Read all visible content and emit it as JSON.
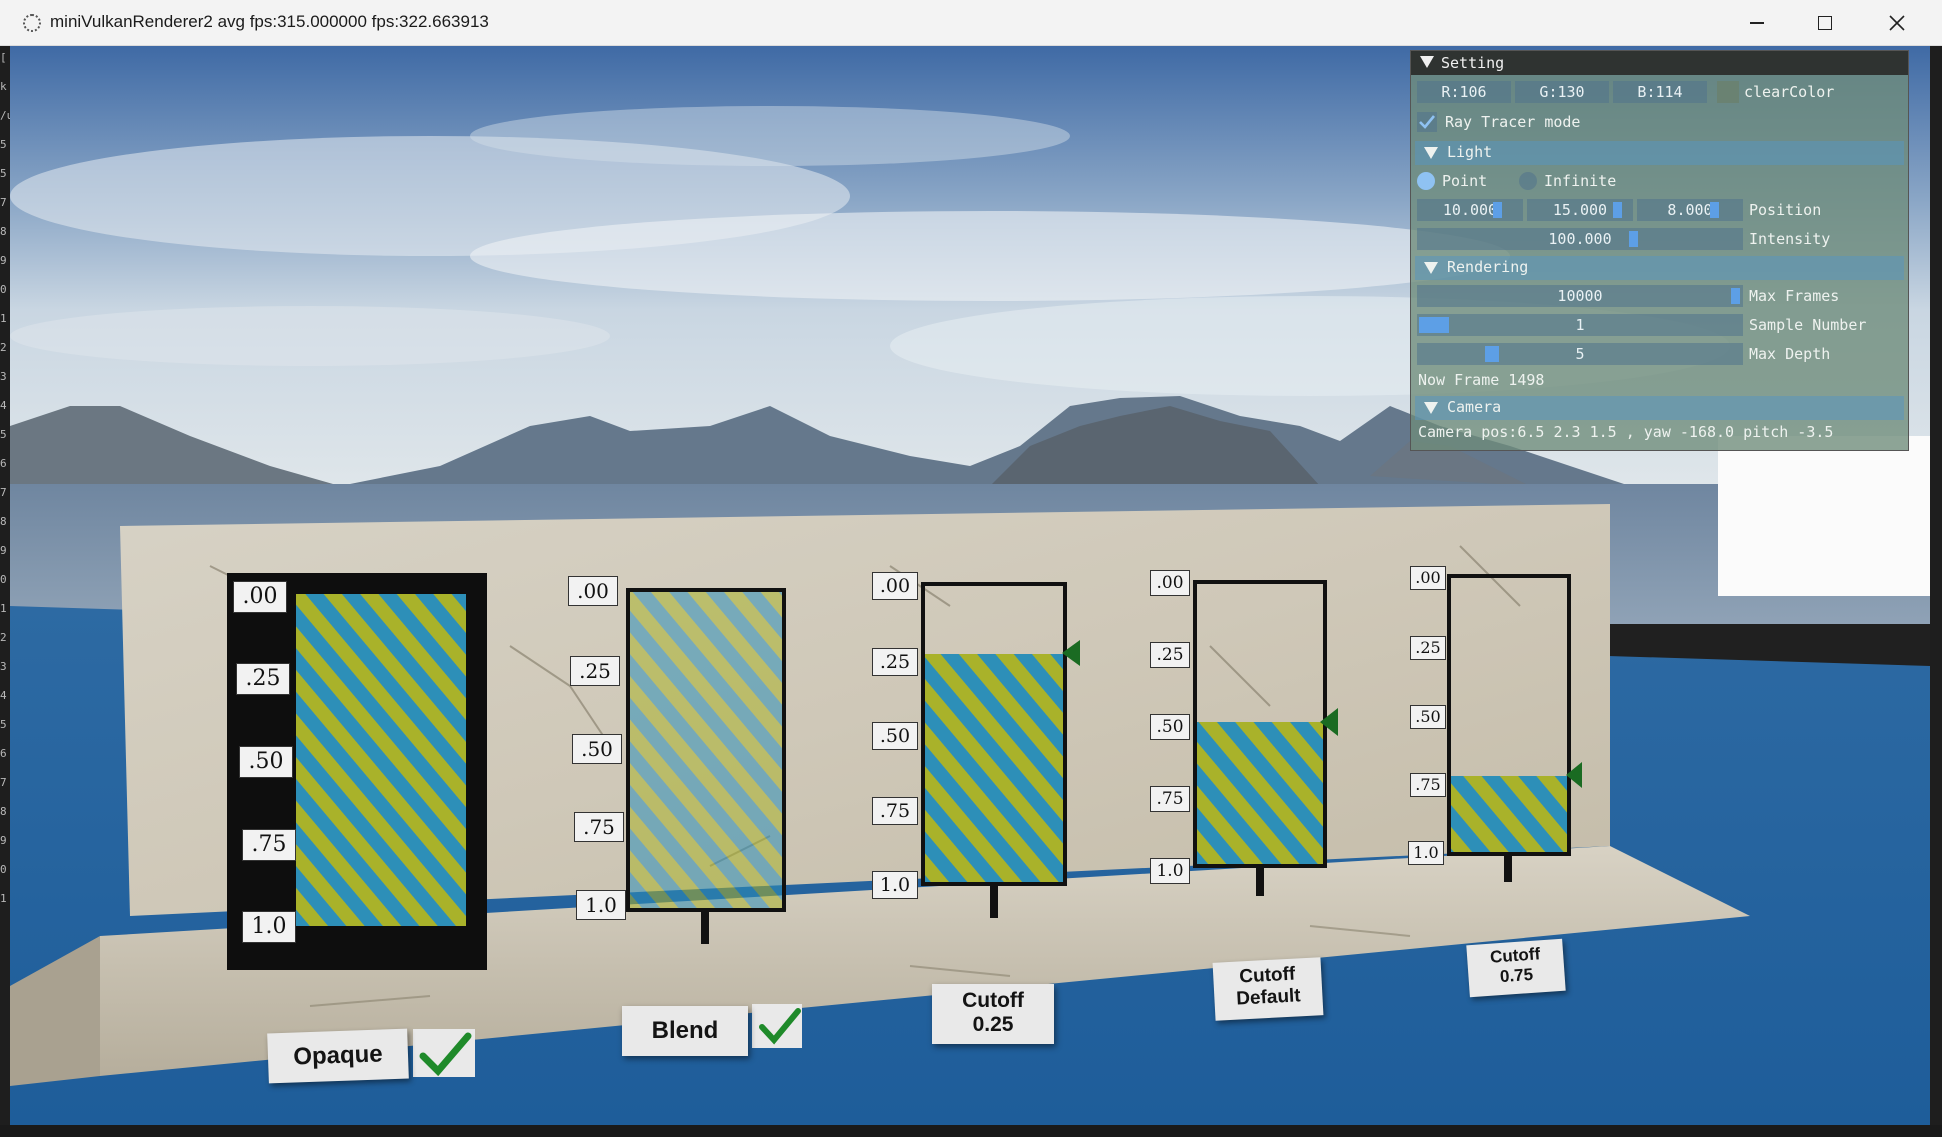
{
  "window": {
    "title": "miniVulkanRenderer2 avg fps:315.000000 fps:322.663913"
  },
  "left_strip": [
    "[",
    "k",
    "/u",
    "5",
    "5",
    "7",
    "8",
    "9",
    "0",
    "1",
    "2",
    "3",
    "4",
    "5",
    "6",
    "7",
    "8",
    "9",
    "0",
    "1",
    "2",
    "3",
    "4",
    "5",
    "6",
    "7",
    "8",
    "9",
    "0",
    "1"
  ],
  "settings": {
    "title": "Setting",
    "clear_color": {
      "r": "R:106",
      "g": "G:130",
      "b": "B:114",
      "label": "clearColor",
      "swatch": "#6a8272"
    },
    "ray_tracer": {
      "label": "Ray Tracer mode",
      "checked": true
    },
    "light": {
      "header": "Light",
      "type_point": "Point",
      "type_infinite": "Infinite",
      "selected": "Point",
      "position": [
        "10.000",
        "15.000",
        "8.000"
      ],
      "position_label": "Position",
      "intensity": "100.000",
      "intensity_label": "Intensity"
    },
    "rendering": {
      "header": "Rendering",
      "max_frames": "10000",
      "max_frames_label": "Max Frames",
      "sample_number": "1",
      "sample_number_label": "Sample Number",
      "max_depth": "5",
      "max_depth_label": "Max Depth",
      "now_frame": "Now Frame 1498"
    },
    "camera": {
      "header": "Camera",
      "info": "Camera pos:6.5 2.3 1.5 , yaw -168.0 pitch -3.5"
    }
  },
  "scene": {
    "scale_labels": [
      ".00",
      ".25",
      ".50",
      ".75",
      "1.0"
    ],
    "plaques": {
      "opaque": "Opaque",
      "blend": "Blend",
      "cutoff_025": [
        "Cutoff",
        "0.25"
      ],
      "cutoff_default": [
        "Cutoff",
        "Default"
      ],
      "cutoff_075": [
        "Cutoff",
        "0.75"
      ]
    },
    "colors": {
      "stripe_yellow": "#a9b22a",
      "stripe_blue": "#2d8fb8",
      "check_green": "#1f8a2a",
      "marker_green": "#1a6b22",
      "water": "#2e6ea5"
    }
  }
}
